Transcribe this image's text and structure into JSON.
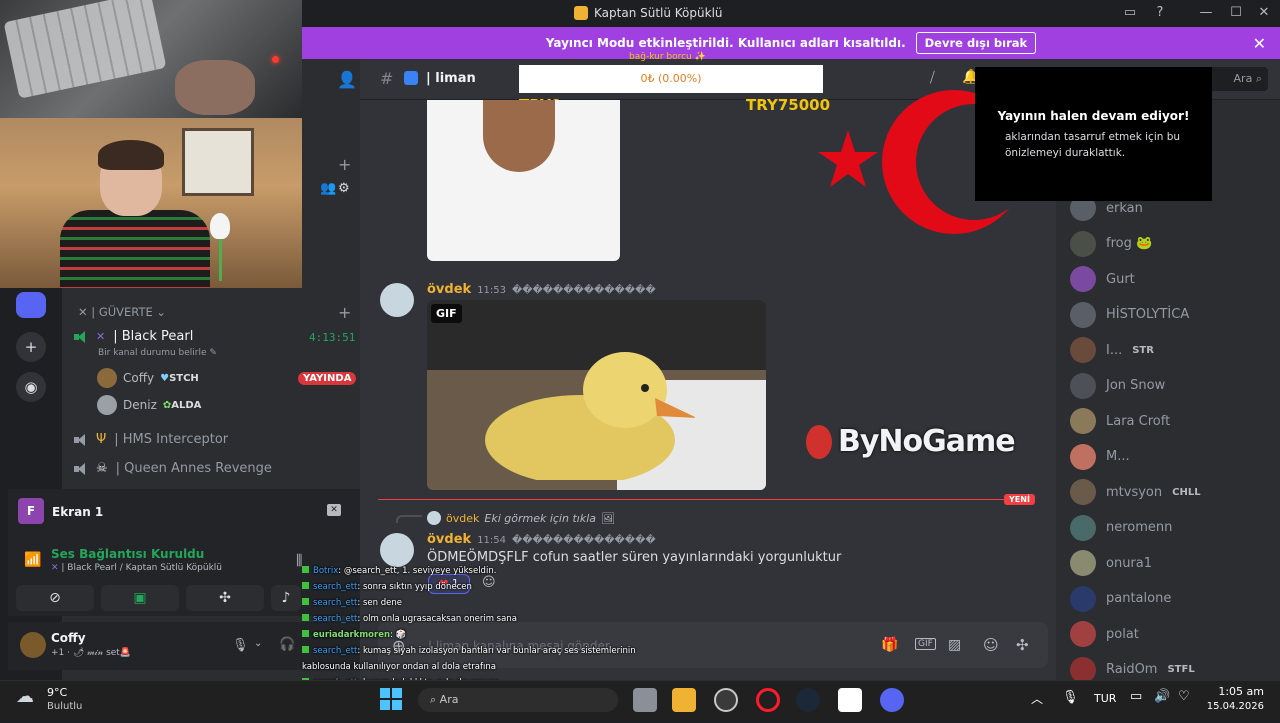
{
  "window": {
    "title": "Kaptan Sütlü Köpüklü"
  },
  "banner": {
    "text": "Yayıncı Modu etkinleştirildi. Kullanıcı adları kısaltıldı.",
    "button": "Devre dışı bırak"
  },
  "channel": {
    "name": "| liman",
    "input_placeholder": "| liman kanalına mesaj gönder",
    "search_placeholder": "Ara"
  },
  "donation": {
    "title": "bağ-kur borcu ✨",
    "progress_text": "0₺ (0.00%)",
    "progress_fraction": 0.0,
    "min_label": "TRY0",
    "max_label": "TRY75000"
  },
  "sidebar": {
    "category": "| GÜVERTE",
    "channels": [
      {
        "name": "| Black Pearl",
        "status": "Bir kanal durumu belirle",
        "timer": "4:13:51",
        "active": true
      },
      {
        "name": "| HMS Interceptor"
      },
      {
        "name": "| Queen Annes Revenge"
      }
    ],
    "voice_users": [
      {
        "name": "Coffy",
        "tag": "STCH",
        "live": "YAYINDA"
      },
      {
        "name": "Deniz",
        "tag": "ALDA"
      }
    ]
  },
  "share_card": {
    "initial": "F",
    "title": "Ekran 1"
  },
  "voice_panel": {
    "status": "Ses Bağlantısı Kuruldu",
    "location": "| Black Pearl / Kaptan Sütlü Köpüklü"
  },
  "user_panel": {
    "name": "Coffy",
    "status": "+1 · 🌶 𝓂𝒾𝓃 set🚨"
  },
  "messages": [
    {
      "author": "övdek",
      "time": "11:53",
      "suffix": "��������������",
      "attachment": "GIF"
    },
    {
      "reply_author": "övdek",
      "reply_text": "Eki görmek için tıkla",
      "author": "övdek",
      "time": "11:54",
      "suffix": "��������������",
      "text": "ÖDMEÖMDŞFLF cofun saatler süren yayınlarındaki yorgunluktur",
      "reaction_count": "1"
    }
  ],
  "new_divider": "YENİ",
  "stream_paused": {
    "title": "Yayının halen devam ediyor!",
    "body": "aklarından tasarruf etmek için bu önizlemeyi duraklattık."
  },
  "members": [
    {
      "name": "erkan"
    },
    {
      "name": "frog 🐸"
    },
    {
      "name": "Gurt"
    },
    {
      "name": "HİSTOLYTİCA"
    },
    {
      "name": "I...",
      "tag": "STR"
    },
    {
      "name": "Jon Snow"
    },
    {
      "name": "Lara Croft"
    },
    {
      "name": "M..."
    },
    {
      "name": "mtvsyon",
      "tag": "CHLL"
    },
    {
      "name": "neromenn"
    },
    {
      "name": "onura1"
    },
    {
      "name": "pantalone"
    },
    {
      "name": "polat"
    },
    {
      "name": "RaidOm",
      "tag": "STFL"
    }
  ],
  "sponsor": {
    "logo_text": "ByNoGame"
  },
  "overlay_chat": [
    {
      "user": "Botrix",
      "text": ": @search_ett, 1. seviyeye yükseldin."
    },
    {
      "user": "search_ett",
      "text": ": sonra sıktın yyıp dönecen"
    },
    {
      "user": "search_ett",
      "text": ": sen dene"
    },
    {
      "user": "search_ett",
      "text": ": olm onla ugrasacaksan onerim sana"
    },
    {
      "user": "euriadarkmoren",
      "text": ": 🎲"
    },
    {
      "user": "search_ett",
      "text": ": kumaş siyah izolasyon bantları var bunlar araç ses sistemlerinin kablosunda kullanılıyor ondan al dola etrafına"
    },
    {
      "user": "search_ett",
      "text": ": benım kulaklıkta oyle dayanıyor"
    },
    {
      "user": "euriadarkmoren",
      "text": ": coff konuşuyorsan eğer vneim sesim kapalı odada yalnız dellim"
    }
  ],
  "taskbar": {
    "weather_temp": "9°C",
    "weather_desc": "Bulutlu",
    "search": "Ara",
    "lang": "TUR",
    "time": "1:05 am",
    "date": "15.04.2026"
  }
}
